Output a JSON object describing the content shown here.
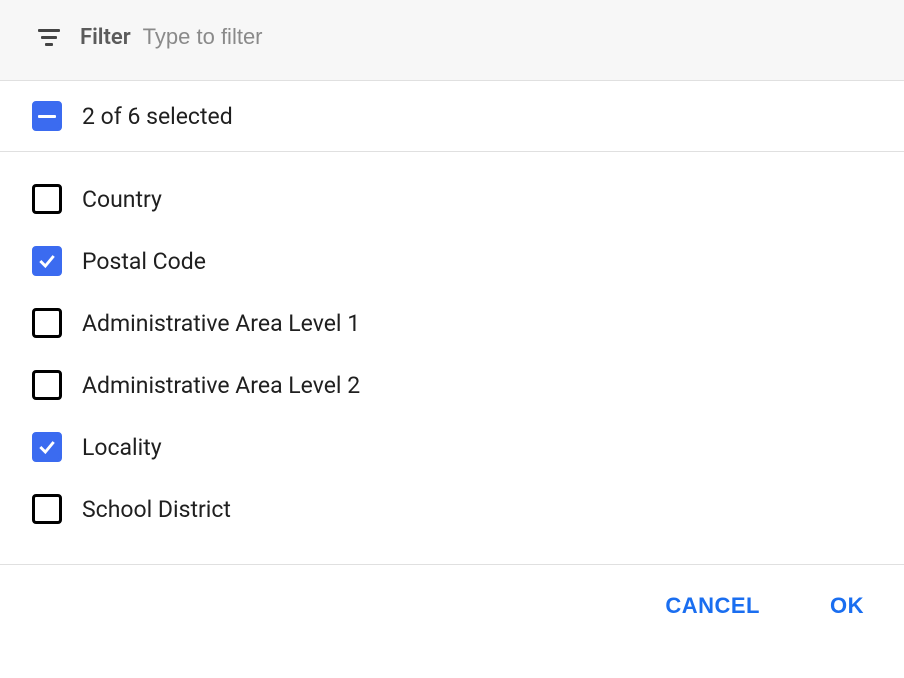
{
  "filter": {
    "label": "Filter",
    "placeholder": "Type to filter",
    "value": ""
  },
  "selection": {
    "summary": "2 of 6 selected",
    "state": "indeterminate"
  },
  "items": [
    {
      "label": "Country",
      "checked": false
    },
    {
      "label": "Postal Code",
      "checked": true
    },
    {
      "label": "Administrative Area Level 1",
      "checked": false
    },
    {
      "label": "Administrative Area Level 2",
      "checked": false
    },
    {
      "label": "Locality",
      "checked": true
    },
    {
      "label": "School District",
      "checked": false
    }
  ],
  "actions": {
    "cancel": "CANCEL",
    "ok": "OK"
  }
}
